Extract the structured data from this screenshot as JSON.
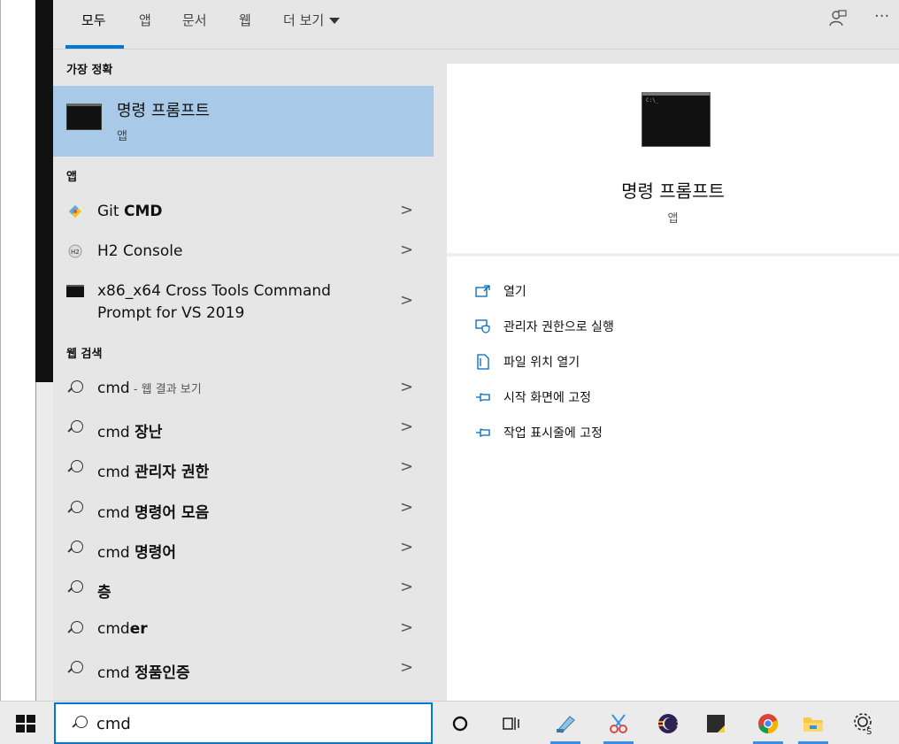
{
  "tabs": [
    {
      "label": "모두",
      "active": true
    },
    {
      "label": "앱"
    },
    {
      "label": "문서"
    },
    {
      "label": "웹"
    },
    {
      "label": "더 보기"
    }
  ],
  "top_icons": {
    "feedback": "feedback-icon",
    "more": "···"
  },
  "sections": {
    "best_match": "가장 정확",
    "apps": "앱",
    "web": "웹 검색"
  },
  "best_match": {
    "title": "명령 프롬프트",
    "subtitle": "앱"
  },
  "apps": [
    {
      "prefix": "Git ",
      "bold": "CMD",
      "icon": "git-icon"
    },
    {
      "prefix": "H2 Console",
      "bold": "",
      "icon": "h2-icon"
    },
    {
      "line1": "x86_x64 Cross Tools Command",
      "line2": "Prompt for VS 2019",
      "icon": "cmd-icon"
    }
  ],
  "web_results": [
    {
      "prefix": "cmd",
      "bold": "",
      "note": " - 웹 결과 보기"
    },
    {
      "prefix": "cmd ",
      "bold": "장난"
    },
    {
      "prefix": "cmd ",
      "bold": "관리자 권한"
    },
    {
      "prefix": "cmd ",
      "bold": "명령어 모음"
    },
    {
      "prefix": "cmd ",
      "bold": "명령어"
    },
    {
      "prefix": "",
      "bold": "층"
    },
    {
      "prefix": "cmd",
      "bold": "er"
    },
    {
      "prefix": "cmd ",
      "bold": "정품인증"
    }
  ],
  "chevron": ">",
  "preview": {
    "title": "명령 프롬프트",
    "subtitle": "앱",
    "actions": [
      {
        "label": "열기",
        "icon": "open-icon"
      },
      {
        "label": "관리자 권한으로 실행",
        "icon": "shield-icon"
      },
      {
        "label": "파일 위치 열기",
        "icon": "file-location-icon"
      },
      {
        "label": "시작 화면에 고정",
        "icon": "pin-icon"
      },
      {
        "label": "작업 표시줄에 고정",
        "icon": "pin-icon"
      }
    ]
  },
  "taskbar": {
    "search_value": "cmd",
    "apps": [
      "cortana-icon",
      "task-view-icon",
      "notepad-icon",
      "snipping-tool-icon",
      "eclipse-icon",
      "sticky-notes-icon",
      "chrome-icon",
      "file-explorer-icon",
      "settings-icon"
    ]
  },
  "colors": {
    "accent": "#0078d7",
    "selected": "#a9c9e8",
    "panel": "#e6e6e6"
  }
}
